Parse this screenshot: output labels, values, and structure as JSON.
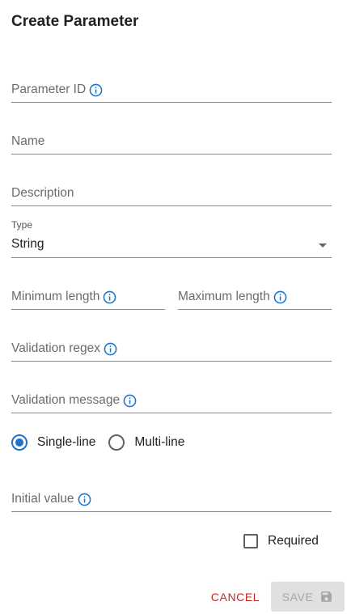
{
  "dialog": {
    "title": "Create Parameter"
  },
  "fields": {
    "parameter_id": {
      "label": "Parameter ID",
      "icon": "info-icon"
    },
    "name": {
      "label": "Name"
    },
    "description": {
      "label": "Description"
    },
    "type": {
      "label": "Type",
      "value": "String"
    },
    "minimum_length": {
      "label": "Minimum length",
      "icon": "info-icon"
    },
    "maximum_length": {
      "label": "Maximum length",
      "icon": "info-icon"
    },
    "validation_regex": {
      "label": "Validation regex",
      "icon": "info-icon"
    },
    "validation_message": {
      "label": "Validation message",
      "icon": "info-icon"
    },
    "initial_value": {
      "label": "Initial value",
      "icon": "info-icon"
    }
  },
  "mode": {
    "options": [
      "Single-line",
      "Multi-line"
    ],
    "selected": "Single-line"
  },
  "required": {
    "label": "Required",
    "checked": false
  },
  "actions": {
    "cancel_label": "CANCEL",
    "save_label": "SAVE",
    "save_icon": "floppy-disk-icon"
  },
  "colors": {
    "accent": "#1e72c8",
    "cancel": "#c62828",
    "disabled_bg": "#e0e0e0",
    "disabled_text": "#a6a6a6"
  }
}
